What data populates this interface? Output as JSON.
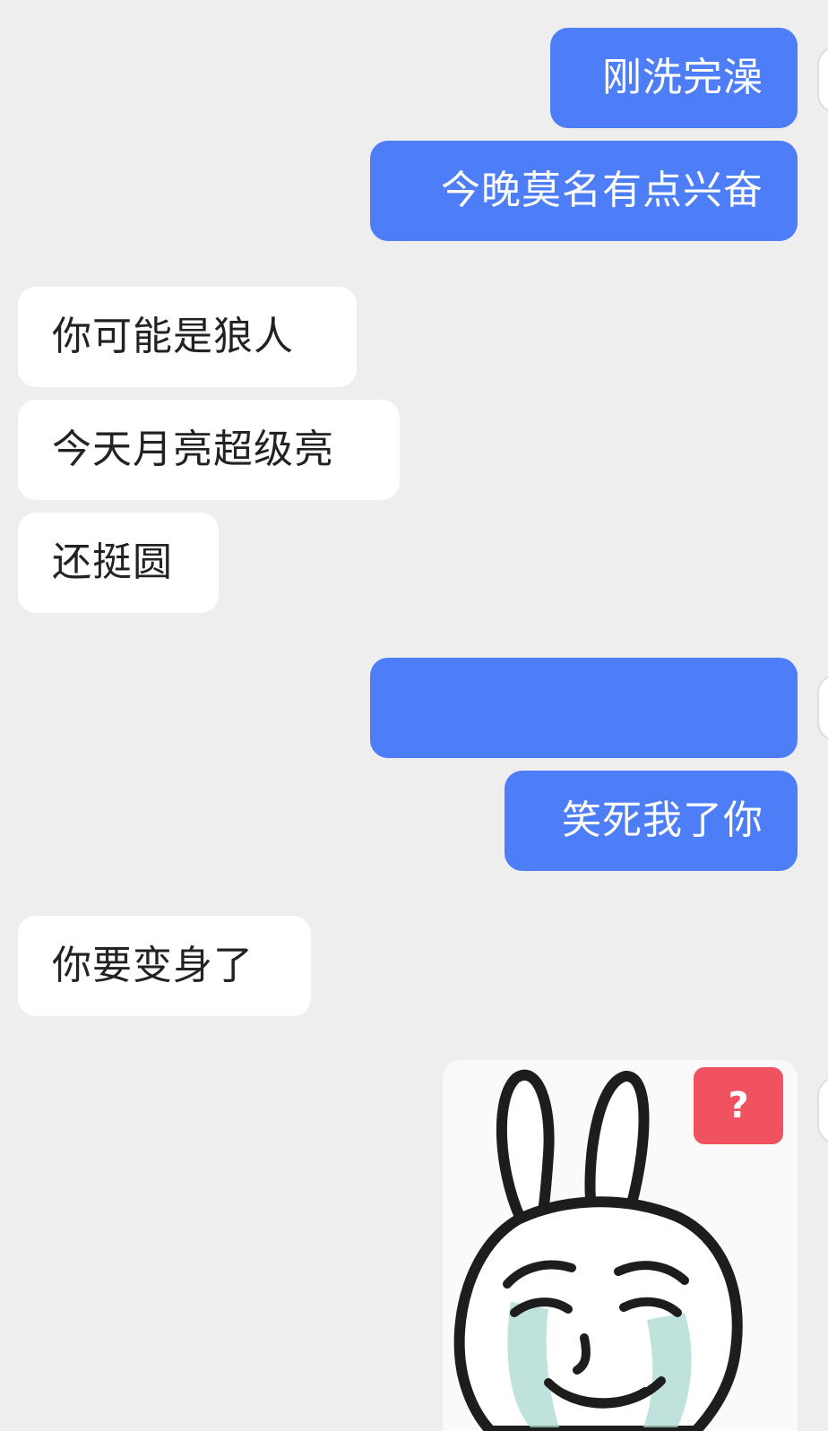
{
  "messages": [
    {
      "side": "out",
      "text": "刚洗完澡"
    },
    {
      "side": "out",
      "text": "今晚莫名有点兴奋"
    },
    {
      "side": "in",
      "text": "你可能是狼人"
    },
    {
      "side": "in",
      "text": "今天月亮超级亮"
    },
    {
      "side": "in",
      "text": "还挺圆"
    },
    {
      "side": "out",
      "text": "",
      "blurred": true
    },
    {
      "side": "out",
      "text": "笑死我了你"
    },
    {
      "side": "in",
      "text": "你要变身了"
    }
  ],
  "sticker": {
    "icon": "crying-bunny-meme",
    "badge": "?"
  },
  "colors": {
    "background": "#eeeeee",
    "outgoing_bubble": "#4d7ef8",
    "incoming_bubble": "#ffffff",
    "badge": "#f0525f"
  }
}
